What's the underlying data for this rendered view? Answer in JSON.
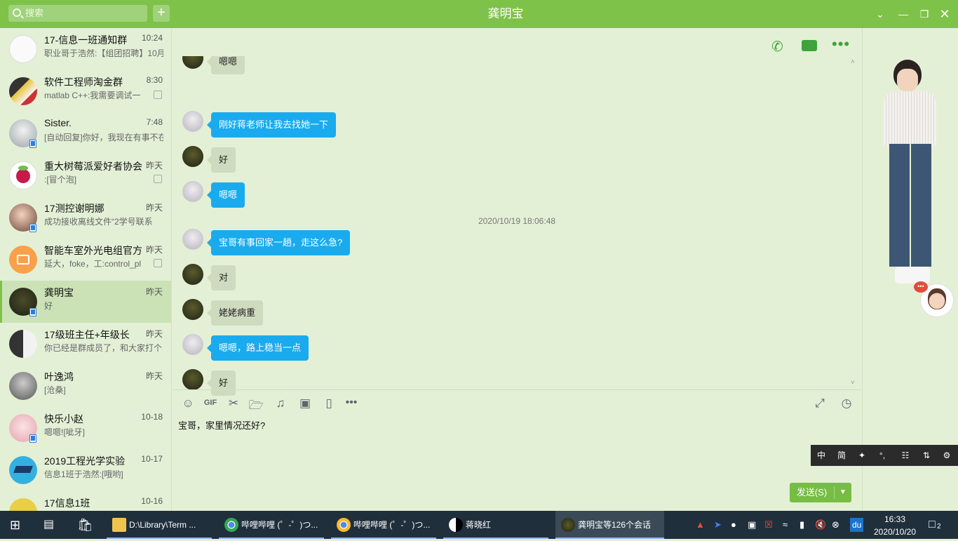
{
  "window": {
    "title": "龚明宝",
    "search_placeholder": "搜索",
    "add": "+"
  },
  "conversations": [
    {
      "name": "17-信息一班通知群",
      "time": "10:24",
      "preview": "职业哥于浩然:【组团招聘】10月",
      "muted": false
    },
    {
      "name": "软件工程师淘金群",
      "time": "8:30",
      "preview": "matlab  C++:我需要调试一",
      "muted": true
    },
    {
      "name": "Sister.",
      "time": "7:48",
      "preview": "[自动回复]你好，我现在有事不在",
      "muted": false
    },
    {
      "name": "重大树莓派爱好者协会",
      "time": "昨天",
      "preview": "     :[冒个泡]",
      "muted": true
    },
    {
      "name": "17测控谢明娜",
      "time": "昨天",
      "preview": "成功接收离线文件“2学号联系",
      "muted": false
    },
    {
      "name": "智能车室外光电组官方",
      "time": "昨天",
      "preview": "延大，foke，工:control_pl",
      "muted": true
    },
    {
      "name": "龚明宝",
      "time": "昨天",
      "preview": "好",
      "muted": false
    },
    {
      "name": "17级班主任+年级长",
      "time": "昨天",
      "preview": "你已经是群成员了，和大家打个",
      "muted": false
    },
    {
      "name": "叶逸鸿",
      "time": "昨天",
      "preview": "[沧桑]",
      "muted": false
    },
    {
      "name": "快乐小赵",
      "time": "10-18",
      "preview": "嗯嗯![呲牙]",
      "muted": false
    },
    {
      "name": "2019工程光学实验",
      "time": "10-17",
      "preview": "信息1班于浩然:[哦哟]",
      "muted": false
    },
    {
      "name": "17信息1班",
      "time": "10-16",
      "preview": "",
      "muted": false
    }
  ],
  "messages": [
    {
      "from": "other",
      "text": "嗯嗯"
    },
    {
      "from": "me",
      "text": "刚好蒋老师让我去找她一下"
    },
    {
      "from": "other",
      "text": "好"
    },
    {
      "from": "me",
      "text": "嗯嗯"
    },
    {
      "from": "me",
      "text": "宝哥有事回家一趟，走这么急?"
    },
    {
      "from": "other",
      "text": "对"
    },
    {
      "from": "other",
      "text": "姥姥病重"
    },
    {
      "from": "me",
      "text": "嗯嗯，路上稳当一点"
    },
    {
      "from": "other",
      "text": "好"
    }
  ],
  "timestamp": "2020/10/19 18:06:48",
  "composer": {
    "text": "宝哥，家里情况还好?",
    "send_label": "发送(S)"
  },
  "toolbar": {
    "gif": "GIF"
  },
  "ime": {
    "zh": "中",
    "jian": "简"
  },
  "taskbar": {
    "apps": [
      "D:\\Library\\Term ...",
      "哔哩哔哩 (゜-゜)つ...",
      "哔哩哔哩 (゜-゜)つ...",
      "蒋晓红",
      "龚明宝等126个会话"
    ],
    "time": "16:33",
    "date": "2020/10/20",
    "badge": "2",
    "du": "du"
  },
  "colors": {
    "accent": "#7ec249",
    "bubble_me": "#1aabee",
    "bubble_other": "#cfdbbf"
  }
}
